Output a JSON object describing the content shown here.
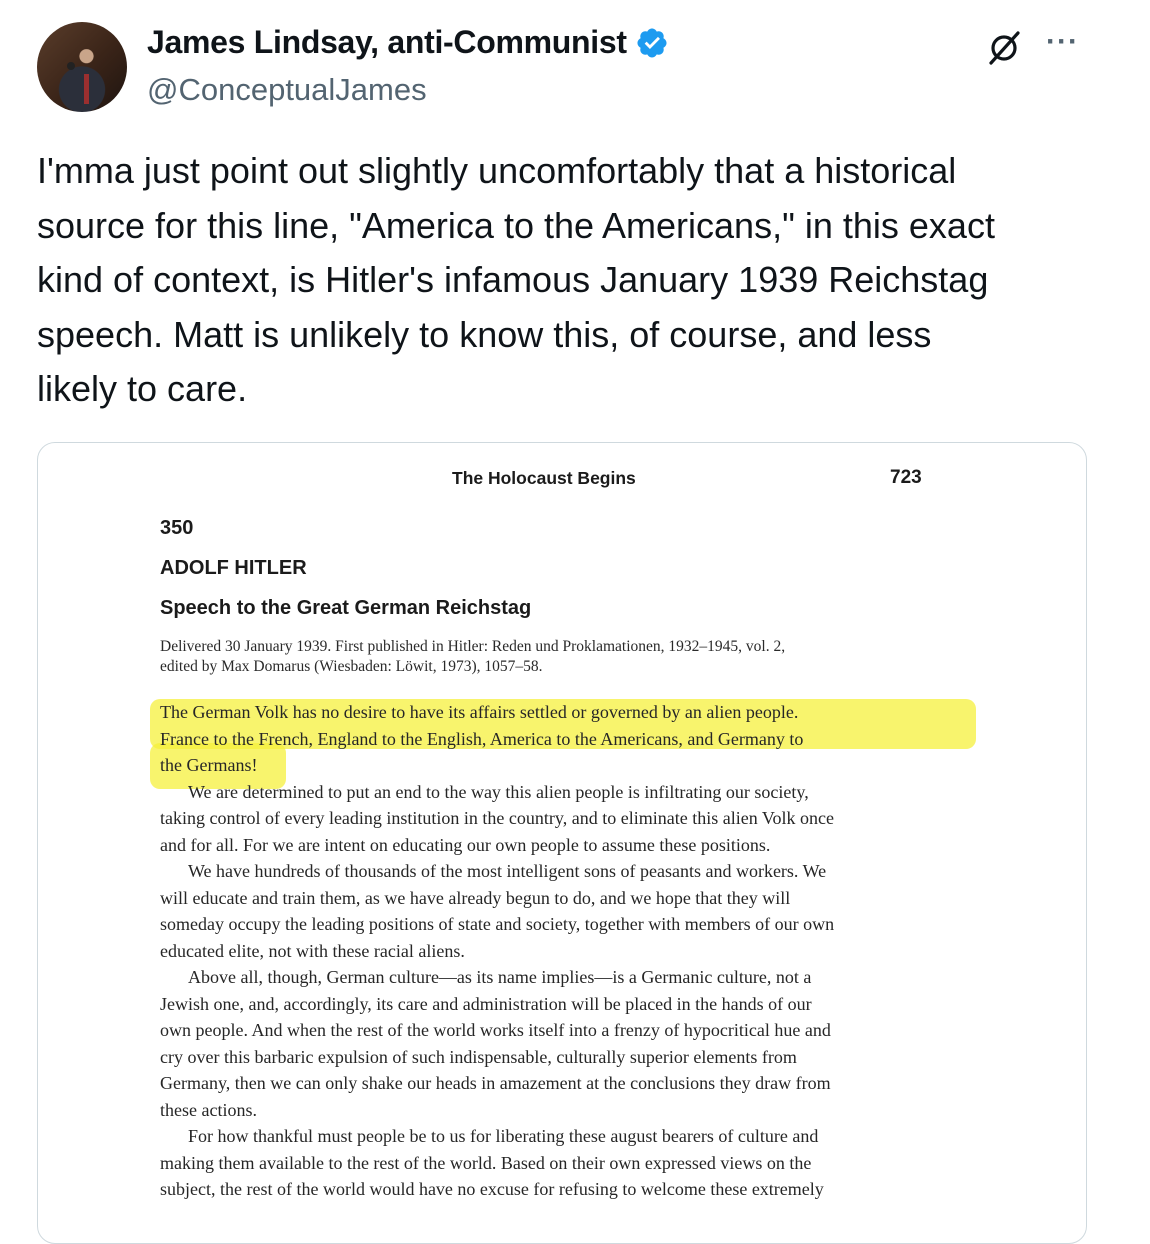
{
  "author": {
    "display_name": "James Lindsay, anti-Communist",
    "handle": "@ConceptualJames",
    "verified_color": "#1d9bf0"
  },
  "icons": {
    "grok": "grok-icon",
    "more": "more-options-icon",
    "verified": "verified-badge-icon"
  },
  "more_glyph": "···",
  "tweet": {
    "lines": [
      "I'mma just point out slightly uncomfortably that a historical",
      "source for this line, \"America to the Americans,\" in this exact",
      "kind of context, is Hitler's infamous January 1939 Reichstag",
      "speech. Matt is unlikely to know this, of course, and less",
      "likely to care."
    ]
  },
  "book_page": {
    "running_head": "The Holocaust Begins",
    "page_number": "723",
    "doc_number": "350",
    "doc_author": "ADOLF HITLER",
    "doc_title": "Speech to the Great German Reichstag",
    "source_lines": [
      "Delivered 30 January 1939. First published in Hitler: Reden und Proklamationen, 1932–1945, vol. 2,",
      "edited by Max Domarus (Wiesbaden: Löwit, 1973), 1057–58."
    ],
    "highlight_color": "#f5f03c",
    "body_lines": [
      "The German Volk has no desire to have its affairs settled or governed by an alien people.",
      "France to the French, England to the English, America to the Americans, and Germany to",
      "the Germans!",
      "We are determined to put an end to the way this alien people is infiltrating our society,",
      "taking control of every leading institution in the country, and to eliminate this alien Volk once",
      "and for all. For we are intent on educating our own people to assume these positions.",
      "We have hundreds of thousands of the most intelligent sons of peasants and workers. We",
      "will educate and train them, as we have already begun to do, and we hope that they will",
      "someday occupy the leading positions of state and society, together with members of our own",
      "educated elite, not with these racial aliens.",
      "Above all, though, German culture—as its name implies—is a Germanic culture, not a",
      "Jewish one, and, accordingly, its care and administration will be placed in the hands of our",
      "own people. And when the rest of the world works itself into a frenzy of hypocritical hue and",
      "cry over this barbaric expulsion of such indispensable, culturally superior elements from",
      "Germany, then we can only shake our heads in amazement at the conclusions they draw from",
      "these actions.",
      "For how thankful must people be to us for liberating these august bearers of culture and",
      "making them available to the rest of the world. Based on their own expressed views on the",
      "subject, the rest of the world would have no excuse for refusing to welcome these extremely"
    ]
  }
}
